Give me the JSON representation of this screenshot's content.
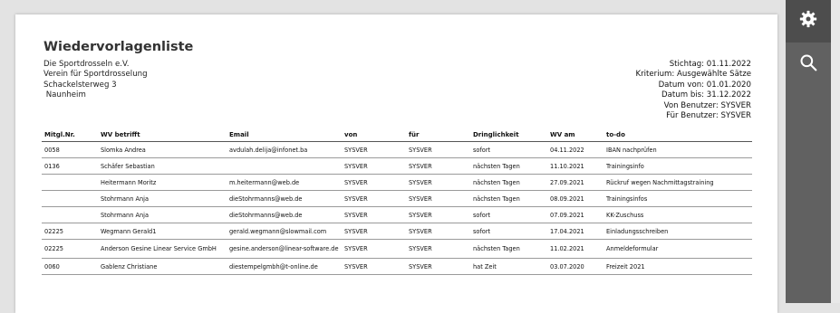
{
  "report": {
    "title": "Wiedervorlagenliste",
    "org_lines": [
      "Die Sportdrosseln e.V.",
      "Verein für Sportdrosselung",
      "Schackelsterweg 3",
      " Naunheim"
    ],
    "meta_lines": [
      "Stichtag: 01.11.2022",
      "Kriterium: Ausgewählte Sätze",
      "Datum von: 01.01.2020",
      "Datum bis: 31.12.2022",
      "Von Benutzer: SYSVER",
      "Für Benutzer: SYSVER"
    ]
  },
  "table": {
    "headers": [
      "Mitgl.Nr.",
      "WV betrifft",
      "Email",
      "von",
      "für",
      "Dringlichkeit",
      "WV am",
      "to-do"
    ],
    "rows": [
      [
        "0058",
        "Slomka Andrea",
        "avdulah.delija@infonet.ba",
        "SYSVER",
        "SYSVER",
        "sofort",
        "04.11.2022",
        "IBAN nachprüfen"
      ],
      [
        "0136",
        "Schäfer Sebastian",
        "",
        "SYSVER",
        "SYSVER",
        "nächsten Tagen",
        "11.10.2021",
        "Trainingsinfo"
      ],
      [
        "",
        "Heitermann Moritz",
        "m.heitermann@web.de",
        "SYSVER",
        "SYSVER",
        "nächsten Tagen",
        "27.09.2021",
        "Rückruf wegen Nachmittagstraining"
      ],
      [
        "",
        "Stohrmann Anja",
        "dieStohrmanns@web.de",
        "SYSVER",
        "SYSVER",
        "nächsten Tagen",
        "08.09.2021",
        "Trainingsinfos"
      ],
      [
        "",
        "Stohrmann Anja",
        "dieStohrmanns@web.de",
        "SYSVER",
        "SYSVER",
        "sofort",
        "07.09.2021",
        "KK-Zuschuss"
      ],
      [
        "02225",
        "Wegmann Gerald1",
        "gerald.wegmann@slowmail.com",
        "SYSVER",
        "SYSVER",
        "sofort",
        "17.04.2021",
        "Einladungsschreiben"
      ],
      [
        "02225",
        "Anderson Gesine Linear Service GmbH",
        "gesine.anderson@linear-software.de",
        "SYSVER",
        "SYSVER",
        "nächsten Tagen",
        "11.02.2021",
        "Anmeldeformular"
      ],
      [
        "0060",
        "Gablenz Christiane",
        "diestempelgmbh@t-online.de",
        "SYSVER",
        "SYSVER",
        "hat Zeit",
        "03.07.2020",
        "Freizeit 2021"
      ]
    ]
  },
  "sidebar": {
    "buttons": [
      {
        "name": "settings",
        "icon": "gear-icon"
      },
      {
        "name": "search",
        "icon": "search-icon"
      }
    ]
  }
}
